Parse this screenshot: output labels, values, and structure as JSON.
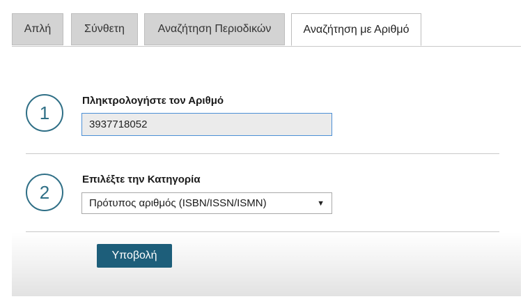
{
  "tabs": [
    {
      "label": "Απλή",
      "active": false
    },
    {
      "label": "Σύνθετη",
      "active": false
    },
    {
      "label": "Αναζήτηση Περιοδικών",
      "active": false
    },
    {
      "label": "Αναζήτηση με Αριθμό",
      "active": true
    }
  ],
  "step1": {
    "number": "1",
    "label": "Πληκτρολογήστε τον Αριθμό",
    "input_value": "3937718052"
  },
  "step2": {
    "number": "2",
    "label": "Επιλέξτε την Κατηγορία",
    "selected": "Πρότυπος αριθμός (ISBN/ISSN/ISMN)",
    "arrow": "▼"
  },
  "submit_label": "Υποβολή",
  "colors": {
    "accent": "#2f6f86",
    "button": "#1d5e7a",
    "input_border": "#4b8fd6",
    "tab_inactive": "#d3d3d3"
  }
}
